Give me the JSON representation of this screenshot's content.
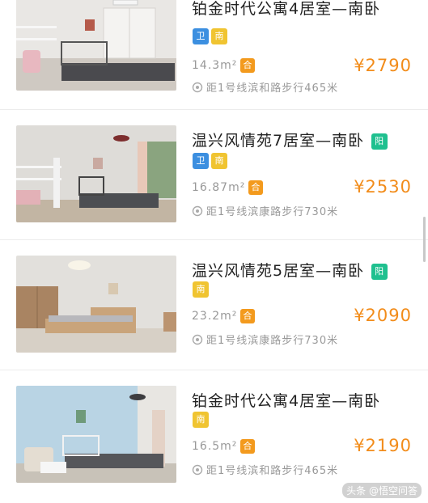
{
  "listings": [
    {
      "title": "铂金时代公寓4居室—南卧",
      "tags": [
        "卫",
        "南"
      ],
      "area": "14.3m²",
      "shared_badge": "合",
      "price": "¥2790",
      "location": "距1号线滨和路步行465米"
    },
    {
      "title": "温兴风情苑7居室—南卧",
      "title_badge": "阳",
      "tags": [
        "卫",
        "南"
      ],
      "area": "16.87m²",
      "shared_badge": "合",
      "price": "¥2530",
      "location": "距1号线滨康路步行730米"
    },
    {
      "title": "温兴风情苑5居室—南卧",
      "title_badge": "阳",
      "tags": [
        "南"
      ],
      "area": "23.2m²",
      "shared_badge": "合",
      "price": "¥2090",
      "location": "距1号线滨康路步行730米"
    },
    {
      "title": "铂金时代公寓4居室—南卧",
      "tags": [
        "南"
      ],
      "area": "16.5m²",
      "shared_badge": "合",
      "price": "¥2190",
      "location": "距1号线滨和路步行465米"
    }
  ],
  "watermark": "头条 @悟空问答",
  "colors": {
    "price": "#f28c1a",
    "tag_blue": "#3c8fe0",
    "tag_yellow": "#f0c431",
    "tag_green": "#1fc08f",
    "shared_badge": "#f39a1d"
  },
  "icons": {
    "location": "location-pin-icon"
  }
}
